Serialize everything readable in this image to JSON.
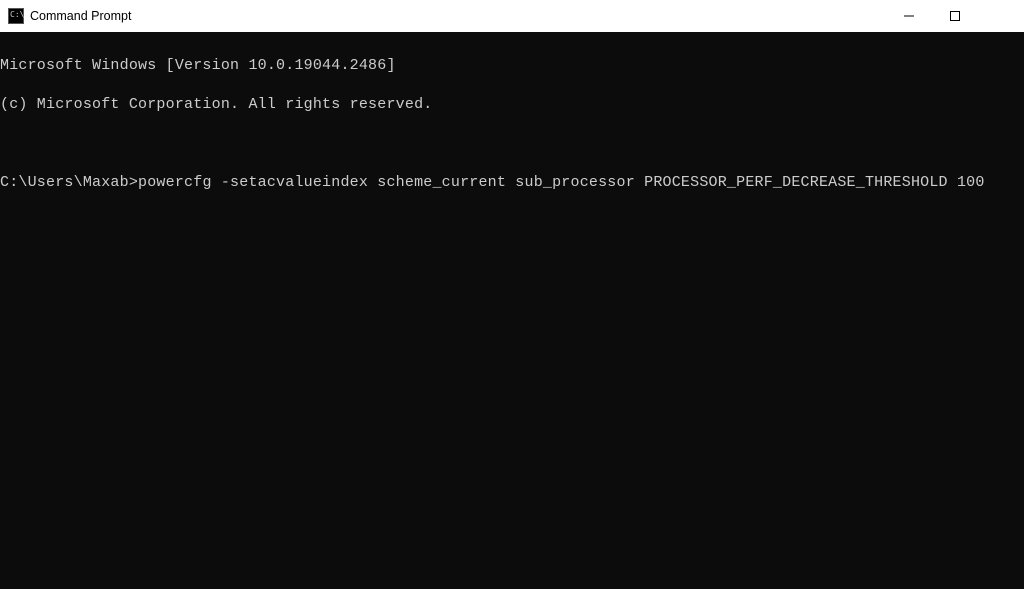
{
  "window": {
    "title": "Command Prompt",
    "icon_glyph": "C:\\"
  },
  "terminal": {
    "lines": {
      "line1": "Microsoft Windows [Version 10.0.19044.2486]",
      "line2": "(c) Microsoft Corporation. All rights reserved."
    },
    "prompt": "C:\\Users\\Maxab>",
    "command": "powercfg -setacvalueindex scheme_current sub_processor PROCESSOR_PERF_DECREASE_THRESHOLD 100"
  }
}
